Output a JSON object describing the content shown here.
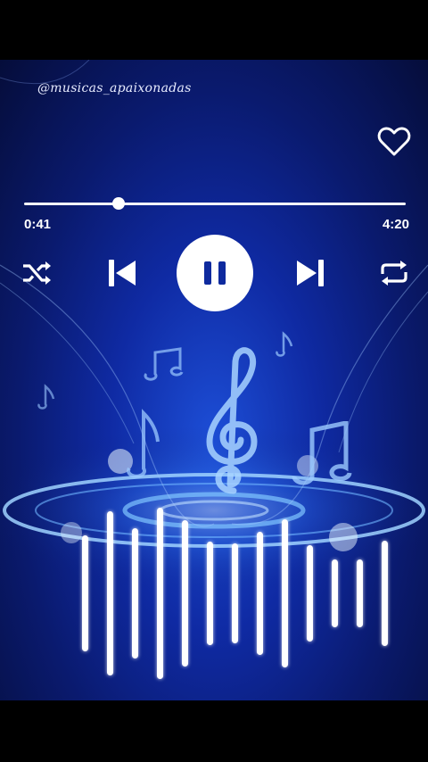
{
  "watermark": "@musicas_apaixonadas",
  "player": {
    "elapsed": "0:41",
    "duration": "4:20",
    "progress_fraction": 0.247
  },
  "icons": {
    "heart": "heart-icon",
    "shuffle": "shuffle-icon",
    "previous": "skip-previous-icon",
    "pause": "pause-icon",
    "next": "skip-next-icon",
    "repeat": "repeat-icon"
  },
  "colors": {
    "background": "#0f2aa3",
    "accent": "#ffffff"
  },
  "visualizer_levels": [
    0.55,
    0.78,
    0.62,
    0.82,
    0.7,
    0.49,
    0.48,
    0.59,
    0.71,
    0.46,
    0.32,
    0.32,
    0.5
  ]
}
